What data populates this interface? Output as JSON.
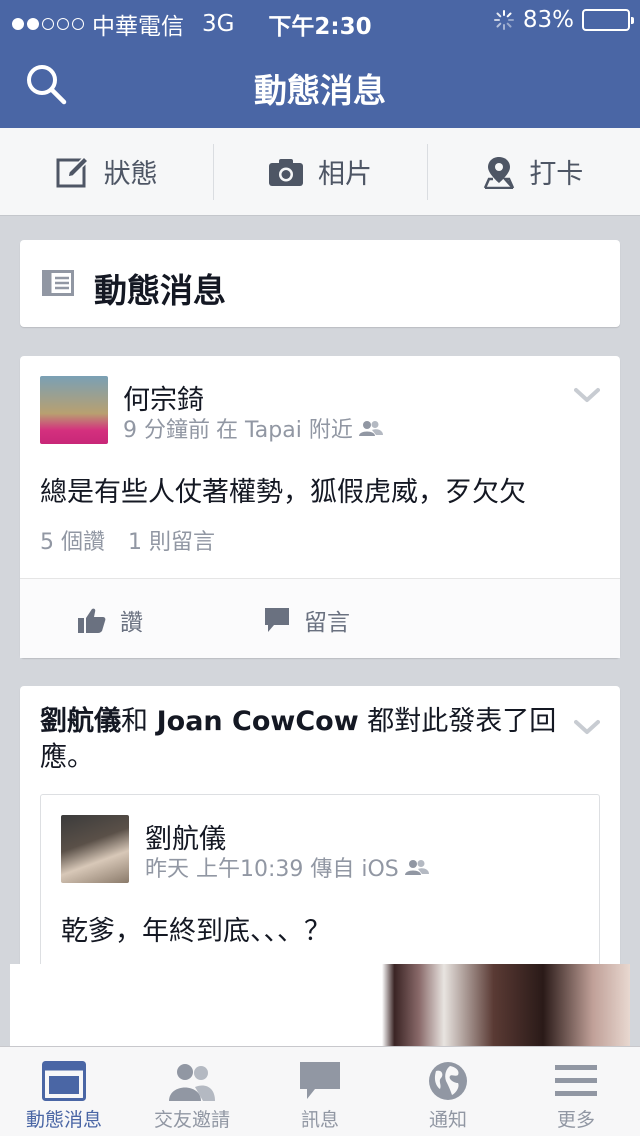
{
  "status": {
    "carrier": "中華電信",
    "network": "3G",
    "time": "下午2:30",
    "battery": "83%",
    "battery_level": 0.83
  },
  "navbar": {
    "title": "動態消息"
  },
  "composer": {
    "status": "狀態",
    "photo": "相片",
    "checkin": "打卡"
  },
  "feed_header": {
    "label": "動態消息"
  },
  "post1": {
    "author": "何宗錡",
    "time": "9 分鐘前",
    "location": "在 Tapai 附近",
    "text": "總是有些人仗著權勢，狐假虎威，歹欠欠",
    "likes": "5 個讚",
    "comments": "1 則留言",
    "like_label": "讚",
    "comment_label": "留言"
  },
  "post2": {
    "story_name": "劉航儀",
    "story_and": "和",
    "story_other": "Joan CowCow",
    "story_suffix": " 都對此發表了回應。",
    "shared_author": "劉航儀",
    "shared_time": "昨天 上午10:39 傳自 iOS",
    "shared_text": "乾爹，年終到底、、、？"
  },
  "tabs": [
    {
      "label": "動態消息",
      "icon": "news-feed-icon"
    },
    {
      "label": "交友邀請",
      "icon": "friends-icon"
    },
    {
      "label": "訊息",
      "icon": "messages-icon"
    },
    {
      "label": "通知",
      "icon": "globe-icon"
    },
    {
      "label": "更多",
      "icon": "menu-icon"
    }
  ],
  "colors": {
    "brand": "#4a66a5",
    "background": "#d3d6db"
  }
}
